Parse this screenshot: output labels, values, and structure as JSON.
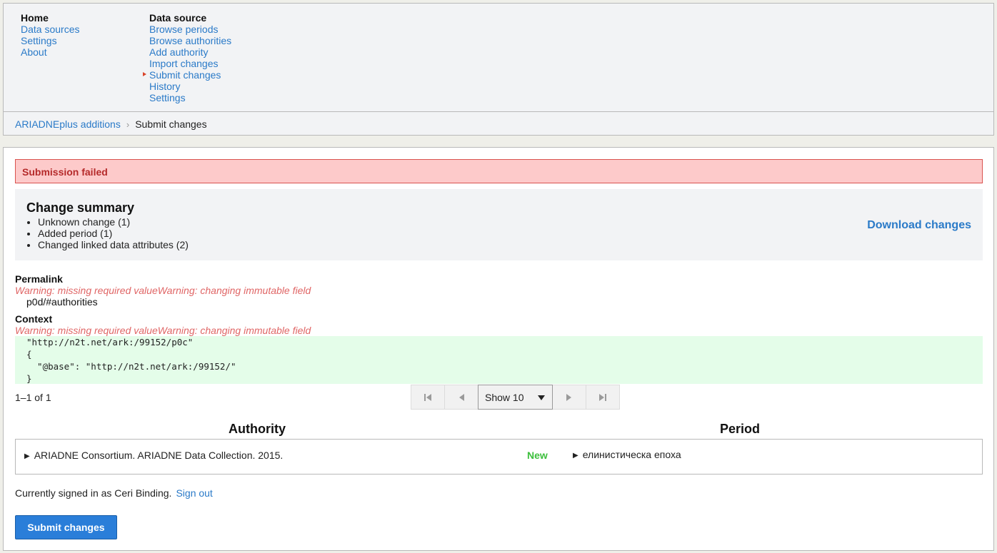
{
  "nav": {
    "col1": {
      "heading": "Home",
      "items": [
        "Data sources",
        "Settings",
        "About"
      ]
    },
    "col2": {
      "heading": "Data source",
      "items": [
        "Browse periods",
        "Browse authorities",
        "Add authority",
        "Import changes",
        "Submit changes",
        "History",
        "Settings"
      ],
      "current_index": 4
    }
  },
  "breadcrumb": {
    "parent": "ARIADNEplus additions",
    "separator": "›",
    "current": "Submit changes"
  },
  "error": {
    "message": "Submission failed"
  },
  "summary": {
    "title": "Change summary",
    "items": [
      "Unknown change (1)",
      "Added period (1)",
      "Changed linked data attributes (2)"
    ],
    "download_label": "Download changes"
  },
  "permalink": {
    "label": "Permalink",
    "warning": "Warning: missing required valueWarning: changing immutable field",
    "value": "p0d/#authorities"
  },
  "context": {
    "label": "Context",
    "warning": "Warning: missing required valueWarning: changing immutable field",
    "code": "\"http://n2t.net/ark:/99152/p0c\"\n{\n  \"@base\": \"http://n2t.net/ark:/99152/\"\n}"
  },
  "pager": {
    "count": "1–1 of 1",
    "page_size_label": "Show 10"
  },
  "table": {
    "headers": {
      "authority": "Authority",
      "period": "Period"
    },
    "row": {
      "authority": "ARIADNE Consortium. ARIADNE Data Collection. 2015.",
      "status": "New",
      "period": "елинистическа епоха"
    }
  },
  "account": {
    "signed_in_text": "Currently signed in as Ceri Binding.",
    "sign_out_label": "Sign out"
  },
  "actions": {
    "submit_label": "Submit changes"
  },
  "colors": {
    "link": "#2a7ac8",
    "error_bg": "#fdcaca",
    "error_text": "#b52a2a",
    "warning_text": "#e06666",
    "code_bg": "#e4fde9",
    "status_new": "#3cbf3c",
    "primary_button": "#2a7ed9"
  }
}
